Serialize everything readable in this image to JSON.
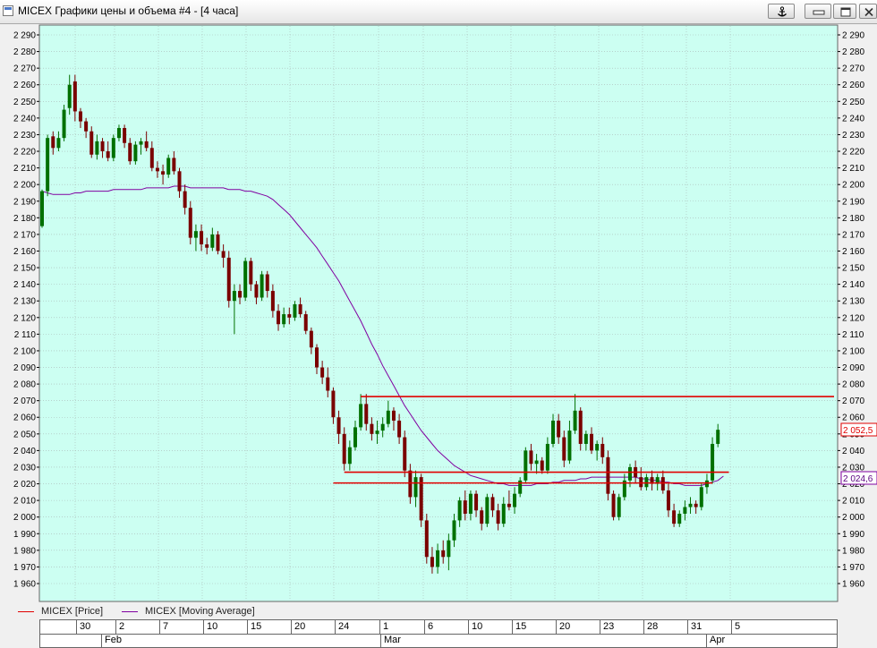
{
  "window": {
    "title": "MICEX Графики цены и объема #4 - [4 часа]"
  },
  "legend": {
    "items": [
      {
        "name": "MICEX [Price]",
        "color": "#e00000"
      },
      {
        "name": "MICEX [Moving Average]",
        "color": "#8000a0"
      }
    ]
  },
  "price_tags": {
    "last_price": "2 052,5",
    "ma_value": "2 024,6"
  },
  "date_axis": {
    "days": [
      "30",
      "2",
      "7",
      "10",
      "15",
      "20",
      "24",
      "1",
      "6",
      "10",
      "15",
      "20",
      "23",
      "28",
      "31",
      "5"
    ],
    "months": [
      "Feb",
      "Mar",
      "Apr"
    ]
  },
  "chart_data": {
    "type": "candlestick",
    "y_ticks": [
      "1 960",
      "1 970",
      "1 980",
      "1 990",
      "2 000",
      "2 010",
      "2 020",
      "2 030",
      "2 040",
      "2 050",
      "2 060",
      "2 070",
      "2 080",
      "2 090",
      "2 100",
      "2 110",
      "2 120",
      "2 130",
      "2 140",
      "2 150",
      "2 160",
      "2 170",
      "2 180",
      "2 190",
      "2 200",
      "2 210",
      "2 220",
      "2 230",
      "2 240",
      "2 250",
      "2 260",
      "2 270",
      "2 280",
      "2 290"
    ],
    "ylim": [
      1955,
      2295
    ],
    "grid": true,
    "colors": {
      "up": "#007000",
      "down": "#7a0000",
      "ma": "#8000a0",
      "hline": "#e00000",
      "background": "#ccfff2",
      "grid": "#a8b8b4"
    },
    "candles": [
      {
        "o": 2175,
        "h": 2197,
        "l": 2174,
        "c": 2196
      },
      {
        "o": 2196,
        "h": 2230,
        "l": 2193,
        "c": 2228
      },
      {
        "o": 2229,
        "h": 2232,
        "l": 2218,
        "c": 2222
      },
      {
        "o": 2222,
        "h": 2232,
        "l": 2220,
        "c": 2228
      },
      {
        "o": 2228,
        "h": 2248,
        "l": 2226,
        "c": 2245
      },
      {
        "o": 2246,
        "h": 2266,
        "l": 2242,
        "c": 2260
      },
      {
        "o": 2262,
        "h": 2266,
        "l": 2238,
        "c": 2244
      },
      {
        "o": 2244,
        "h": 2246,
        "l": 2234,
        "c": 2238
      },
      {
        "o": 2238,
        "h": 2240,
        "l": 2228,
        "c": 2232
      },
      {
        "o": 2232,
        "h": 2235,
        "l": 2216,
        "c": 2218
      },
      {
        "o": 2218,
        "h": 2230,
        "l": 2215,
        "c": 2226
      },
      {
        "o": 2226,
        "h": 2228,
        "l": 2216,
        "c": 2220
      },
      {
        "o": 2220,
        "h": 2226,
        "l": 2214,
        "c": 2216
      },
      {
        "o": 2216,
        "h": 2230,
        "l": 2214,
        "c": 2228
      },
      {
        "o": 2228,
        "h": 2236,
        "l": 2226,
        "c": 2234
      },
      {
        "o": 2234,
        "h": 2236,
        "l": 2222,
        "c": 2225
      },
      {
        "o": 2225,
        "h": 2228,
        "l": 2212,
        "c": 2214
      },
      {
        "o": 2214,
        "h": 2226,
        "l": 2212,
        "c": 2224
      },
      {
        "o": 2224,
        "h": 2228,
        "l": 2218,
        "c": 2226
      },
      {
        "o": 2226,
        "h": 2232,
        "l": 2220,
        "c": 2222
      },
      {
        "o": 2222,
        "h": 2226,
        "l": 2208,
        "c": 2210
      },
      {
        "o": 2210,
        "h": 2214,
        "l": 2204,
        "c": 2208
      },
      {
        "o": 2208,
        "h": 2212,
        "l": 2200,
        "c": 2206
      },
      {
        "o": 2206,
        "h": 2218,
        "l": 2204,
        "c": 2216
      },
      {
        "o": 2216,
        "h": 2220,
        "l": 2206,
        "c": 2208
      },
      {
        "o": 2208,
        "h": 2210,
        "l": 2192,
        "c": 2196
      },
      {
        "o": 2196,
        "h": 2200,
        "l": 2182,
        "c": 2186
      },
      {
        "o": 2186,
        "h": 2190,
        "l": 2164,
        "c": 2168
      },
      {
        "o": 2168,
        "h": 2176,
        "l": 2160,
        "c": 2172
      },
      {
        "o": 2172,
        "h": 2176,
        "l": 2160,
        "c": 2164
      },
      {
        "o": 2164,
        "h": 2168,
        "l": 2158,
        "c": 2162
      },
      {
        "o": 2162,
        "h": 2174,
        "l": 2160,
        "c": 2170
      },
      {
        "o": 2170,
        "h": 2172,
        "l": 2158,
        "c": 2160
      },
      {
        "o": 2160,
        "h": 2164,
        "l": 2150,
        "c": 2156
      },
      {
        "o": 2156,
        "h": 2160,
        "l": 2126,
        "c": 2130
      },
      {
        "o": 2130,
        "h": 2140,
        "l": 2110,
        "c": 2136
      },
      {
        "o": 2136,
        "h": 2140,
        "l": 2128,
        "c": 2132
      },
      {
        "o": 2132,
        "h": 2156,
        "l": 2130,
        "c": 2154
      },
      {
        "o": 2154,
        "h": 2156,
        "l": 2136,
        "c": 2140
      },
      {
        "o": 2140,
        "h": 2142,
        "l": 2128,
        "c": 2132
      },
      {
        "o": 2132,
        "h": 2148,
        "l": 2130,
        "c": 2146
      },
      {
        "o": 2146,
        "h": 2148,
        "l": 2132,
        "c": 2136
      },
      {
        "o": 2136,
        "h": 2140,
        "l": 2120,
        "c": 2124
      },
      {
        "o": 2124,
        "h": 2128,
        "l": 2112,
        "c": 2116
      },
      {
        "o": 2116,
        "h": 2126,
        "l": 2114,
        "c": 2122
      },
      {
        "o": 2122,
        "h": 2126,
        "l": 2116,
        "c": 2120
      },
      {
        "o": 2120,
        "h": 2130,
        "l": 2118,
        "c": 2128
      },
      {
        "o": 2128,
        "h": 2132,
        "l": 2120,
        "c": 2122
      },
      {
        "o": 2122,
        "h": 2124,
        "l": 2110,
        "c": 2112
      },
      {
        "o": 2112,
        "h": 2114,
        "l": 2098,
        "c": 2102
      },
      {
        "o": 2102,
        "h": 2104,
        "l": 2086,
        "c": 2090
      },
      {
        "o": 2090,
        "h": 2094,
        "l": 2080,
        "c": 2084
      },
      {
        "o": 2084,
        "h": 2090,
        "l": 2072,
        "c": 2076
      },
      {
        "o": 2076,
        "h": 2078,
        "l": 2056,
        "c": 2060
      },
      {
        "o": 2060,
        "h": 2064,
        "l": 2044,
        "c": 2050
      },
      {
        "o": 2050,
        "h": 2054,
        "l": 2028,
        "c": 2032
      },
      {
        "o": 2032,
        "h": 2046,
        "l": 2028,
        "c": 2042
      },
      {
        "o": 2042,
        "h": 2058,
        "l": 2040,
        "c": 2054
      },
      {
        "o": 2054,
        "h": 2074,
        "l": 2052,
        "c": 2068
      },
      {
        "o": 2068,
        "h": 2074,
        "l": 2052,
        "c": 2056
      },
      {
        "o": 2056,
        "h": 2060,
        "l": 2046,
        "c": 2050
      },
      {
        "o": 2050,
        "h": 2058,
        "l": 2044,
        "c": 2052
      },
      {
        "o": 2052,
        "h": 2060,
        "l": 2048,
        "c": 2056
      },
      {
        "o": 2056,
        "h": 2070,
        "l": 2054,
        "c": 2064
      },
      {
        "o": 2064,
        "h": 2066,
        "l": 2052,
        "c": 2058
      },
      {
        "o": 2058,
        "h": 2062,
        "l": 2044,
        "c": 2048
      },
      {
        "o": 2048,
        "h": 2052,
        "l": 2024,
        "c": 2028
      },
      {
        "o": 2028,
        "h": 2032,
        "l": 2008,
        "c": 2012
      },
      {
        "o": 2012,
        "h": 2028,
        "l": 2006,
        "c": 2024
      },
      {
        "o": 2024,
        "h": 2026,
        "l": 1994,
        "c": 1998
      },
      {
        "o": 1998,
        "h": 2002,
        "l": 1972,
        "c": 1976
      },
      {
        "o": 1976,
        "h": 1982,
        "l": 1966,
        "c": 1970
      },
      {
        "o": 1970,
        "h": 1984,
        "l": 1966,
        "c": 1980
      },
      {
        "o": 1980,
        "h": 1986,
        "l": 1972,
        "c": 1976
      },
      {
        "o": 1976,
        "h": 1990,
        "l": 1968,
        "c": 1986
      },
      {
        "o": 1986,
        "h": 2002,
        "l": 1982,
        "c": 1998
      },
      {
        "o": 1998,
        "h": 2012,
        "l": 1994,
        "c": 2010
      },
      {
        "o": 2010,
        "h": 2016,
        "l": 1998,
        "c": 2002
      },
      {
        "o": 2002,
        "h": 2016,
        "l": 1998,
        "c": 2014
      },
      {
        "o": 2014,
        "h": 2016,
        "l": 2000,
        "c": 2004
      },
      {
        "o": 2004,
        "h": 2006,
        "l": 1992,
        "c": 1996
      },
      {
        "o": 1996,
        "h": 2014,
        "l": 1994,
        "c": 2012
      },
      {
        "o": 2012,
        "h": 2014,
        "l": 2000,
        "c": 2004
      },
      {
        "o": 2004,
        "h": 2008,
        "l": 1992,
        "c": 1996
      },
      {
        "o": 1996,
        "h": 2012,
        "l": 1994,
        "c": 2008
      },
      {
        "o": 2008,
        "h": 2016,
        "l": 2004,
        "c": 2006
      },
      {
        "o": 2006,
        "h": 2018,
        "l": 2002,
        "c": 2014
      },
      {
        "o": 2014,
        "h": 2024,
        "l": 2012,
        "c": 2022
      },
      {
        "o": 2022,
        "h": 2042,
        "l": 2020,
        "c": 2040
      },
      {
        "o": 2040,
        "h": 2044,
        "l": 2028,
        "c": 2032
      },
      {
        "o": 2032,
        "h": 2038,
        "l": 2026,
        "c": 2034
      },
      {
        "o": 2034,
        "h": 2036,
        "l": 2026,
        "c": 2028
      },
      {
        "o": 2028,
        "h": 2048,
        "l": 2026,
        "c": 2044
      },
      {
        "o": 2044,
        "h": 2062,
        "l": 2042,
        "c": 2058
      },
      {
        "o": 2058,
        "h": 2062,
        "l": 2044,
        "c": 2048
      },
      {
        "o": 2048,
        "h": 2052,
        "l": 2030,
        "c": 2034
      },
      {
        "o": 2034,
        "h": 2058,
        "l": 2032,
        "c": 2052
      },
      {
        "o": 2052,
        "h": 2074,
        "l": 2050,
        "c": 2064
      },
      {
        "o": 2064,
        "h": 2066,
        "l": 2040,
        "c": 2044
      },
      {
        "o": 2044,
        "h": 2052,
        "l": 2040,
        "c": 2050
      },
      {
        "o": 2050,
        "h": 2054,
        "l": 2038,
        "c": 2040
      },
      {
        "o": 2040,
        "h": 2046,
        "l": 2034,
        "c": 2044
      },
      {
        "o": 2044,
        "h": 2048,
        "l": 2032,
        "c": 2036
      },
      {
        "o": 2036,
        "h": 2040,
        "l": 2010,
        "c": 2014
      },
      {
        "o": 2014,
        "h": 2016,
        "l": 1998,
        "c": 2000
      },
      {
        "o": 2000,
        "h": 2014,
        "l": 1998,
        "c": 2012
      },
      {
        "o": 2012,
        "h": 2026,
        "l": 2010,
        "c": 2022
      },
      {
        "o": 2022,
        "h": 2032,
        "l": 2018,
        "c": 2030
      },
      {
        "o": 2030,
        "h": 2034,
        "l": 2020,
        "c": 2024
      },
      {
        "o": 2024,
        "h": 2030,
        "l": 2016,
        "c": 2018
      },
      {
        "o": 2018,
        "h": 2026,
        "l": 2016,
        "c": 2024
      },
      {
        "o": 2024,
        "h": 2028,
        "l": 2016,
        "c": 2020
      },
      {
        "o": 2020,
        "h": 2026,
        "l": 2016,
        "c": 2024
      },
      {
        "o": 2024,
        "h": 2028,
        "l": 2014,
        "c": 2016
      },
      {
        "o": 2016,
        "h": 2020,
        "l": 2000,
        "c": 2004
      },
      {
        "o": 2004,
        "h": 2008,
        "l": 1994,
        "c": 1996
      },
      {
        "o": 1996,
        "h": 2004,
        "l": 1994,
        "c": 2002
      },
      {
        "o": 2002,
        "h": 2010,
        "l": 1998,
        "c": 2006
      },
      {
        "o": 2006,
        "h": 2012,
        "l": 2002,
        "c": 2008
      },
      {
        "o": 2008,
        "h": 2010,
        "l": 2002,
        "c": 2006
      },
      {
        "o": 2006,
        "h": 2020,
        "l": 2004,
        "c": 2018
      },
      {
        "o": 2018,
        "h": 2026,
        "l": 2014,
        "c": 2022
      },
      {
        "o": 2022,
        "h": 2048,
        "l": 2020,
        "c": 2044
      },
      {
        "o": 2044,
        "h": 2056,
        "l": 2042,
        "c": 2052.5
      }
    ],
    "moving_average": [
      2196,
      2195,
      2194,
      2194,
      2194,
      2194,
      2195,
      2195,
      2196,
      2196,
      2196,
      2196,
      2196,
      2197,
      2197,
      2197,
      2197,
      2197,
      2197,
      2198,
      2198,
      2198,
      2198,
      2198,
      2199,
      2199,
      2199,
      2198,
      2198,
      2198,
      2198,
      2198,
      2198,
      2198,
      2197,
      2197,
      2197,
      2196,
      2196,
      2195,
      2194,
      2193,
      2191,
      2188,
      2185,
      2182,
      2178,
      2174,
      2170,
      2166,
      2162,
      2157,
      2152,
      2147,
      2142,
      2136,
      2130,
      2124,
      2118,
      2111,
      2104,
      2098,
      2091,
      2085,
      2079,
      2073,
      2067,
      2062,
      2057,
      2052,
      2048,
      2044,
      2040,
      2037,
      2034,
      2031,
      2029,
      2027,
      2025,
      2024,
      2023,
      2022,
      2021,
      2020,
      2020,
      2019,
      2019,
      2019,
      2019,
      2019,
      2020,
      2020,
      2020,
      2021,
      2021,
      2022,
      2022,
      2022,
      2023,
      2023,
      2024,
      2024,
      2024,
      2024,
      2024,
      2024,
      2024,
      2024,
      2024,
      2023,
      2023,
      2022,
      2022,
      2021,
      2021,
      2020,
      2020,
      2019,
      2019,
      2019,
      2019,
      2020,
      2021,
      2022,
      2024.6
    ],
    "horizontal_lines": [
      {
        "y": 2072.5,
        "from_index": 58,
        "to_end": true
      },
      {
        "y": 2027,
        "from_index": 55,
        "to_index": 125
      },
      {
        "y": 2020.5,
        "from_index": 53,
        "to_index": 122
      }
    ]
  }
}
